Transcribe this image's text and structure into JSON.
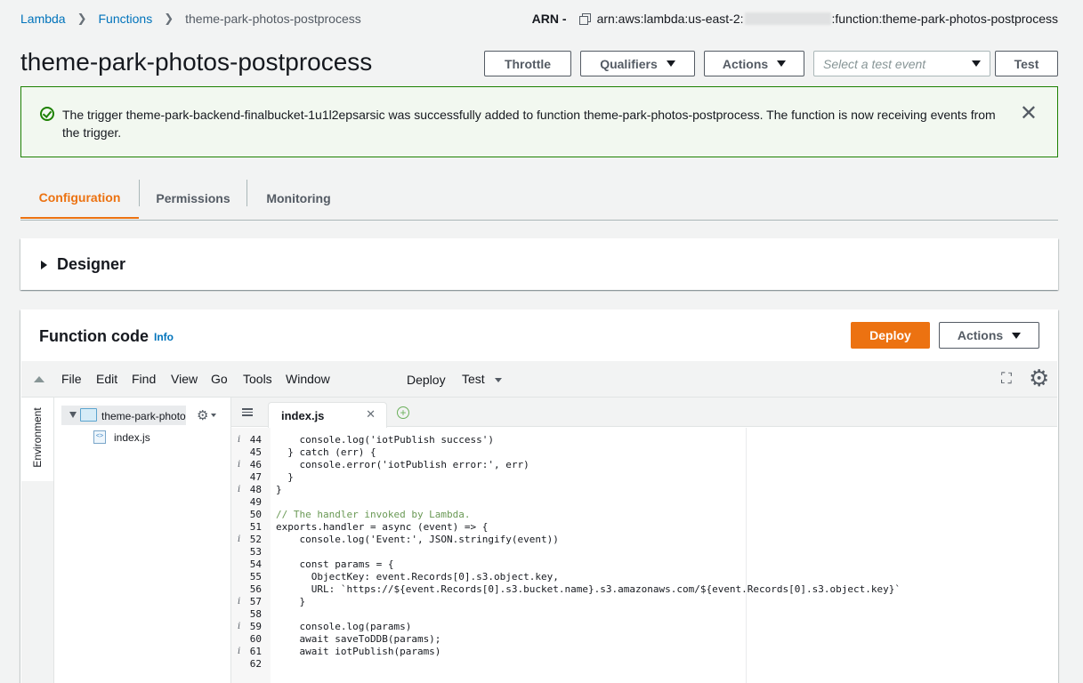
{
  "breadcrumb": {
    "lambda": "Lambda",
    "functions": "Functions",
    "current": "theme-park-photos-postprocess"
  },
  "arn": {
    "label": "ARN -",
    "prefix": "arn:aws:lambda:us-east-2:",
    "suffix": ":function:theme-park-photos-postprocess"
  },
  "page_title": "theme-park-photos-postprocess",
  "toolbar": {
    "throttle": "Throttle",
    "qualifiers": "Qualifiers",
    "actions": "Actions",
    "test_event_placeholder": "Select a test event",
    "test": "Test"
  },
  "flash": {
    "message": "The trigger theme-park-backend-finalbucket-1u1l2epsarsic was successfully added to function theme-park-photos-postprocess. The function is now receiving events from the trigger."
  },
  "tabs": [
    "Configuration",
    "Permissions",
    "Monitoring"
  ],
  "designer": {
    "title": "Designer"
  },
  "function_code": {
    "title": "Function code",
    "info": "Info",
    "deploy": "Deploy",
    "actions": "Actions"
  },
  "ide": {
    "menu": [
      "File",
      "Edit",
      "Find",
      "View",
      "Go",
      "Tools",
      "Window"
    ],
    "deploy": "Deploy",
    "test": "Test",
    "environment": "Environment",
    "folder": "theme-park-photos-",
    "file": "index.js",
    "open_tab": "index.js",
    "code": [
      {
        "n": "44",
        "i": true,
        "t": "    console.log('iotPublish success')"
      },
      {
        "n": "45",
        "i": false,
        "t": "  } catch (err) {"
      },
      {
        "n": "46",
        "i": true,
        "t": "    console.error('iotPublish error:', err)"
      },
      {
        "n": "47",
        "i": false,
        "t": "  }"
      },
      {
        "n": "48",
        "i": true,
        "t": "}"
      },
      {
        "n": "49",
        "i": false,
        "t": ""
      },
      {
        "n": "50",
        "i": false,
        "t": "// The handler invoked by Lambda."
      },
      {
        "n": "51",
        "i": false,
        "t": "exports.handler = async (event) => {"
      },
      {
        "n": "52",
        "i": true,
        "t": "    console.log('Event:', JSON.stringify(event))"
      },
      {
        "n": "53",
        "i": false,
        "t": ""
      },
      {
        "n": "54",
        "i": false,
        "t": "    const params = {"
      },
      {
        "n": "55",
        "i": false,
        "t": "      ObjectKey: event.Records[0].s3.object.key,"
      },
      {
        "n": "56",
        "i": false,
        "t": "      URL: `https://${event.Records[0].s3.bucket.name}.s3.amazonaws.com/${event.Records[0].s3.object.key}`"
      },
      {
        "n": "57",
        "i": true,
        "t": "    }"
      },
      {
        "n": "58",
        "i": false,
        "t": ""
      },
      {
        "n": "59",
        "i": true,
        "t": "    console.log(params)"
      },
      {
        "n": "60",
        "i": false,
        "t": "    await saveToDDB(params);"
      },
      {
        "n": "61",
        "i": true,
        "t": "    await iotPublish(params)"
      },
      {
        "n": "62",
        "i": false,
        "t": ""
      }
    ]
  },
  "colors": {
    "accent": "#ec7211",
    "link": "#0073bb",
    "success": "#1d8102"
  },
  "icons": [
    "chevron-right-icon",
    "copy-icon",
    "caret-down-icon",
    "check-circle-icon",
    "close-icon",
    "triangle-right-icon",
    "expand-icon",
    "gear-icon",
    "folder-icon",
    "js-file-icon",
    "plus-icon",
    "file-list-icon",
    "collapse-up-icon",
    "info-icon"
  ]
}
